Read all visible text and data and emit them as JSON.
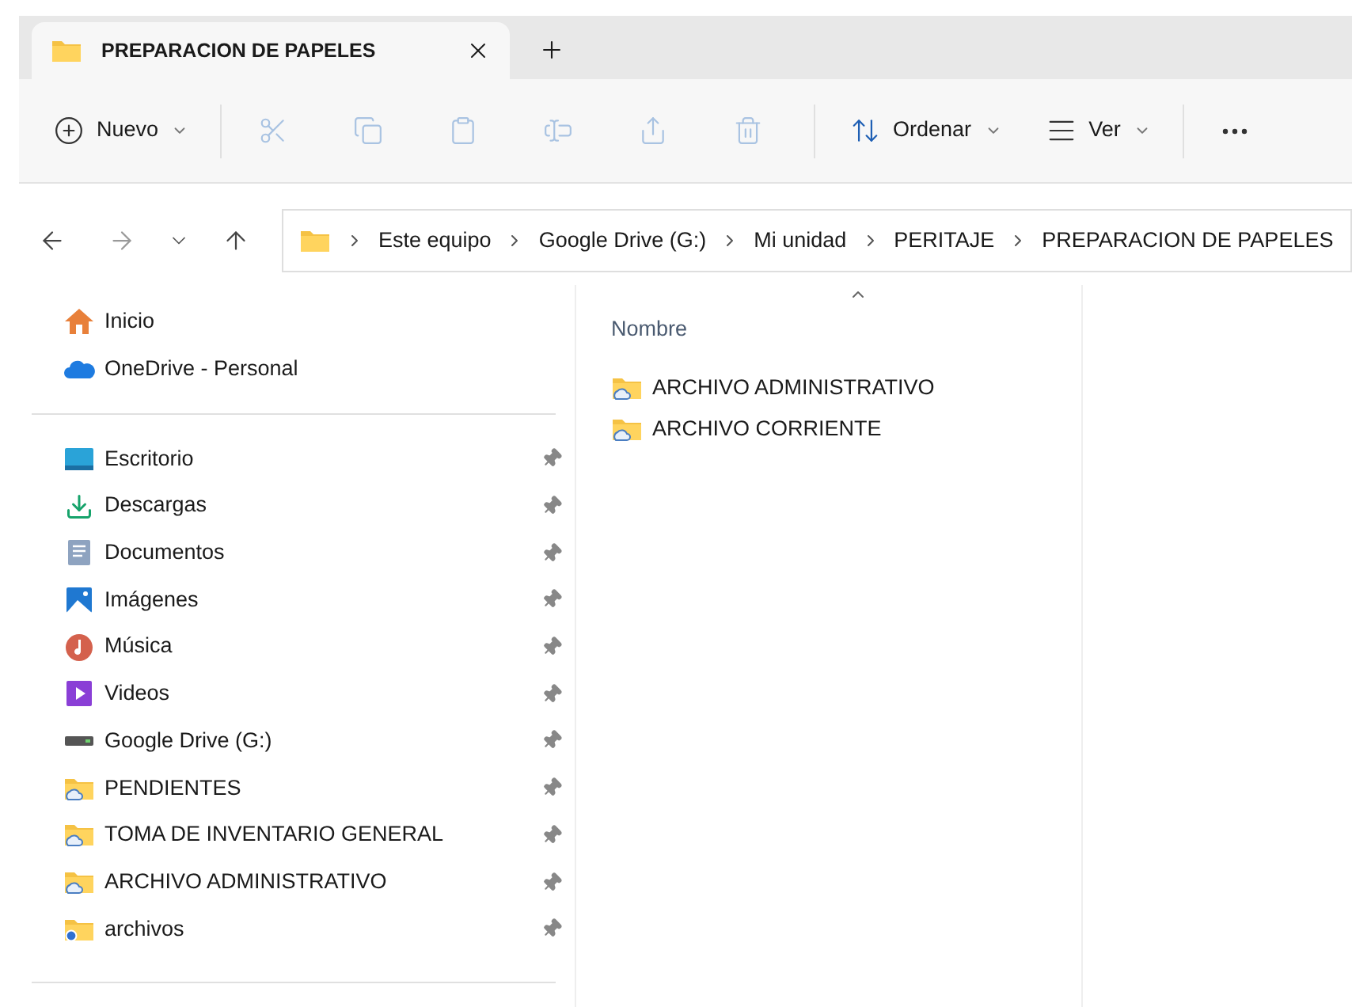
{
  "tab": {
    "title": "PREPARACION DE PAPELES",
    "selected": true
  },
  "toolbar": [
    {
      "kind": "new",
      "label": "Nuevo",
      "disabled": false
    },
    {
      "kind": "cut",
      "disabled": true
    },
    {
      "kind": "copy",
      "disabled": true
    },
    {
      "kind": "paste",
      "disabled": true
    },
    {
      "kind": "rename",
      "disabled": true
    },
    {
      "kind": "share",
      "disabled": true
    },
    {
      "kind": "delete",
      "disabled": true
    },
    {
      "kind": "sort",
      "label": "Ordenar",
      "disabled": false
    },
    {
      "kind": "view",
      "label": "Ver",
      "disabled": false
    },
    {
      "kind": "more",
      "disabled": false
    }
  ],
  "breadcrumb": [
    "Este equipo",
    "Google Drive (G:)",
    "Mi unidad",
    "PERITAJE",
    "PREPARACION DE PAPELES"
  ],
  "sidebar": {
    "top": [
      {
        "kind": "home",
        "label": "Inicio"
      },
      {
        "kind": "onedrive",
        "label": "OneDrive - Personal"
      }
    ],
    "pinned": [
      {
        "kind": "desktop",
        "label": "Escritorio",
        "pinned": true
      },
      {
        "kind": "downloads",
        "label": "Descargas",
        "pinned": true
      },
      {
        "kind": "documents",
        "label": "Documentos",
        "pinned": true
      },
      {
        "kind": "pictures",
        "label": "Imágenes",
        "pinned": true
      },
      {
        "kind": "music",
        "label": "Música",
        "pinned": true
      },
      {
        "kind": "videos",
        "label": "Videos",
        "pinned": true
      },
      {
        "kind": "drive",
        "label": "Google Drive (G:)",
        "pinned": true
      },
      {
        "kind": "cloud-folder",
        "label": "PENDIENTES",
        "pinned": true
      },
      {
        "kind": "cloud-folder",
        "label": "TOMA DE INVENTARIO GENERAL",
        "pinned": true
      },
      {
        "kind": "cloud-folder",
        "label": "ARCHIVO ADMINISTRATIVO",
        "pinned": true
      },
      {
        "kind": "sync-folder",
        "label": "archivos",
        "pinned": true
      }
    ]
  },
  "files": {
    "column": {
      "label": "Nombre",
      "sort_ascending": true
    },
    "rows": [
      {
        "name": "ARCHIVO ADMINISTRATIVO"
      },
      {
        "name": "ARCHIVO CORRIENTE"
      }
    ]
  }
}
